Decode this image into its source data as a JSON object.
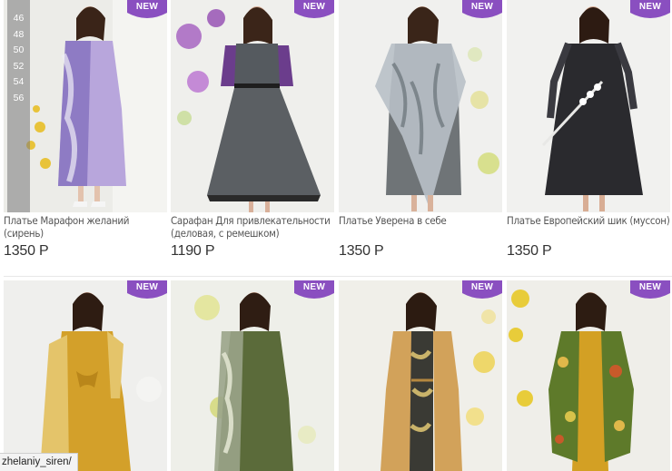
{
  "badge_label": "NEW",
  "colors": {
    "badge": "#8a4fc0",
    "sizes_overlay": "#8a8a8a"
  },
  "sizes": [
    "46",
    "48",
    "50",
    "52",
    "54",
    "56"
  ],
  "products": [
    {
      "title": "Платье Марафон желаний (сирень)",
      "price": "1350 Р"
    },
    {
      "title": "Сарафан Для привлекательности (деловая, с ремешком)",
      "price": "1190 Р"
    },
    {
      "title": "Платье Уверена в себе",
      "price": "1350 Р"
    },
    {
      "title": "Платье Европейский шик (муссон)",
      "price": "1350 Р"
    },
    {
      "title": "",
      "price": ""
    },
    {
      "title": "",
      "price": ""
    },
    {
      "title": "",
      "price": ""
    },
    {
      "title": "",
      "price": ""
    }
  ],
  "status_url": "zhelaniy_siren/"
}
